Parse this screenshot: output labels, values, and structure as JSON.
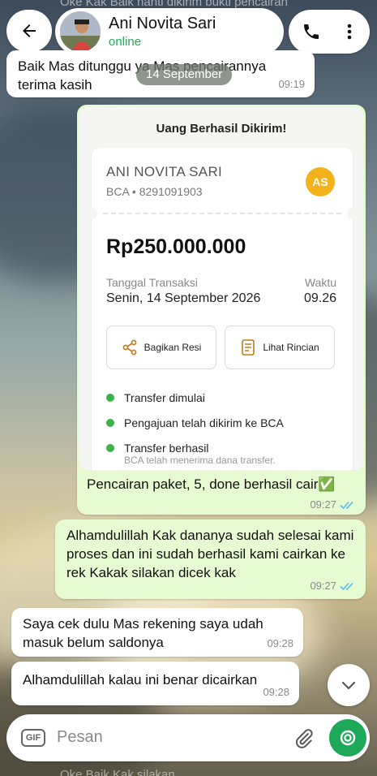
{
  "header": {
    "contact_name": "Ani Novita Sari",
    "status": "online"
  },
  "ghost_top": "Oke Kak Baik nanti dikirim bukti pencairan",
  "date_chip": "14 September",
  "messages": [
    {
      "text": "Baik Mas ditunggu ya Mas pencairannya terima kasih",
      "time": "09:19"
    },
    {
      "caption": "Pencairan paket, 5, done berhasil cair✅",
      "time": "09:27"
    },
    {
      "text": "Alhamdulillah Kak dananya sudah selesai kami proses dan ini sudah berhasil kami cairkan ke rek Kakak silakan dicek kak",
      "time": "09:27"
    },
    {
      "text": "Saya cek dulu Mas rekening saya udah masuk belum saldonya",
      "time": "09:28"
    },
    {
      "text": "Alhamdulillah kalau ini benar dicairkan",
      "time": "09:28"
    }
  ],
  "receipt": {
    "title": "Uang Berhasil Dikirim!",
    "recipient_name": "ANI NOVITA SARI",
    "bank_account": "BCA • 8291091903",
    "initials": "AS",
    "initials_color": "#f3b21b",
    "amount": "Rp250.000.000",
    "date_label": "Tanggal Transaksi",
    "date_value": "Senin, 14 September 2026",
    "time_label": "Waktu",
    "time_value": "09.26",
    "share_label": "Bagikan Resi",
    "details_label": "Lihat Rincian",
    "steps": [
      "Transfer dimulai",
      "Pengajuan telah dikirim ke BCA",
      "Transfer berhasil"
    ],
    "step_sub": "BCA telah menerima dana transfer."
  },
  "input": {
    "placeholder": "Pesan",
    "gif_label": "GIF"
  },
  "ghost_bottom": "Oke Baik Kak silakan",
  "colors": {
    "accent_green": "#1ea95a",
    "outgoing_bubble": "#e7fbd3",
    "read_ticks": "#53bdeb"
  }
}
